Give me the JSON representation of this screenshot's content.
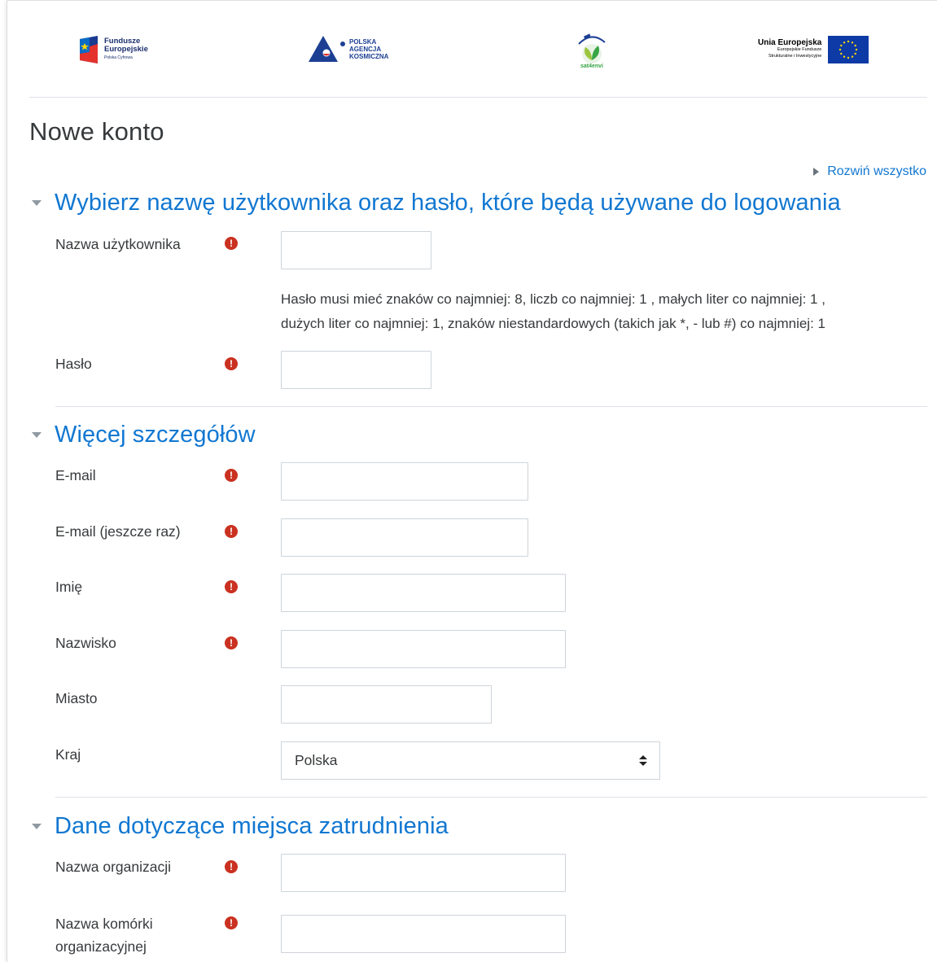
{
  "logos": {
    "fe_line1": "Fundusze",
    "fe_line2": "Europejskie",
    "fe_line3": "Polska Cyfrowa",
    "pak_line1": "POLSKA",
    "pak_line2": "AGENCJA",
    "pak_line3": "KOSMICZNA",
    "s4e": "sat4envi",
    "ue_line1": "Unia Europejska",
    "ue_line2": "Europejskie Fundusze",
    "ue_line3": "Strukturalne i Inwestycyjne"
  },
  "page": {
    "title": "Nowe konto",
    "expand_all": "Rozwiń wszystko"
  },
  "sections": {
    "login": {
      "title": "Wybierz nazwę użytkownika oraz hasło, które będą używane do logowania",
      "username_label": "Nazwa użytkownika",
      "password_hint_line1": "Hasło musi mieć znaków co najmniej: 8, liczb co najmniej: 1 , małych liter co najmniej: 1 ,",
      "password_hint_line2": "dużych liter co najmniej: 1, znaków niestandardowych (takich jak *, - lub #) co najmniej: 1",
      "password_label": "Hasło"
    },
    "details": {
      "title": "Więcej szczegółów",
      "email_label": "E-mail",
      "email2_label": "E-mail (jeszcze raz)",
      "firstname_label": "Imię",
      "lastname_label": "Nazwisko",
      "city_label": "Miasto",
      "country_label": "Kraj",
      "country_value": "Polska"
    },
    "employment": {
      "title": "Dane dotyczące miejsca zatrudnienia",
      "org_label": "Nazwa organizacji",
      "unit_label_line1": "Nazwa komórki",
      "unit_label_line2": "organizacyjnej"
    }
  },
  "required_mark": "!",
  "colors": {
    "link": "#1177d1",
    "required": "#ca3120",
    "text": "#373a3c"
  }
}
